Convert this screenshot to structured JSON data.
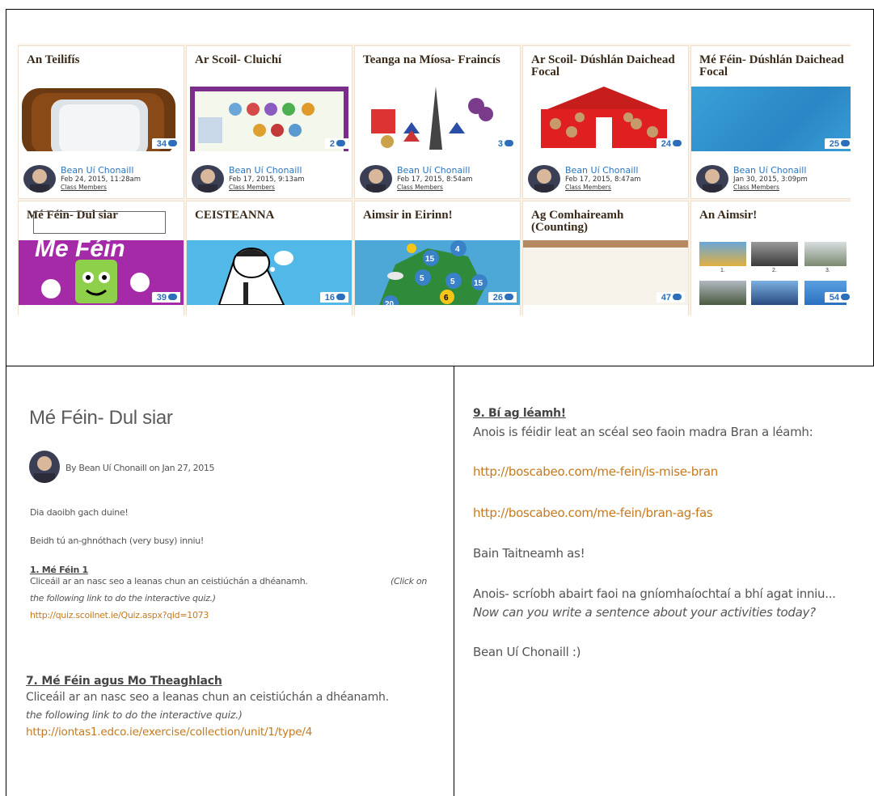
{
  "cards": [
    {
      "title": "An Teilifís",
      "count": "34",
      "author": "Bean Uí Chonaill",
      "date": "Feb 24, 2015, 11:28am",
      "group": "Class Members"
    },
    {
      "title": "Ar Scoil- Cluichí",
      "count": "2",
      "author": "Bean Uí Chonaill",
      "date": "Feb 17, 2015, 9:13am",
      "group": "Class Members"
    },
    {
      "title": "Teanga na Míosa- Fraincís",
      "count": "3",
      "author": "Bean Uí Chonaill",
      "date": "Feb 17, 2015, 8:54am",
      "group": "Class Members"
    },
    {
      "title": "Ar Scoil- Dúshlán Daichead Focal",
      "count": "24",
      "author": "Bean Uí Chonaill",
      "date": "Feb 17, 2015, 8:47am",
      "group": "Class Members"
    },
    {
      "title": "Mé Féin- Dúshlán Daichead Focal",
      "count": "25",
      "author": "Bean Uí Chonaill",
      "date": "Jan 30, 2015, 3:09pm",
      "group": "Class Members"
    },
    {
      "title": "Mé Féin- Dul siar",
      "count": "39",
      "image_text": "Me Féin"
    },
    {
      "title": "CEISTEANNA",
      "count": "16"
    },
    {
      "title": "Aimsir in Eirinn!",
      "count": "26",
      "map_numbers": [
        "4",
        "15",
        "5",
        "5",
        "15",
        "6",
        "20"
      ]
    },
    {
      "title": "Ag Comhaireamh (Counting)",
      "count": "47"
    },
    {
      "title": "An Aimsir!",
      "count": "54",
      "thumb_labels": [
        "1.",
        "2.",
        "3."
      ]
    }
  ],
  "article": {
    "title": "Mé Féin- Dul siar",
    "byline": "By Bean Uí Chonaill on Jan 27, 2015",
    "greeting": "Dia daoibh gach duine!",
    "busy": "Beidh tú an-ghnóthach (very busy) inniu!",
    "s1_heading": "1. Mé Féin 1",
    "s1_text": "Cliceáil ar an nasc seo a leanas chun an ceistiúchán a dhéanamh.",
    "s1_click": "(Click on",
    "s1_italic": "the following link to do the interactive quiz.)",
    "s1_link": "http://quiz.scoilnet.ie/Quiz.aspx?qid=1073",
    "s7_heading": "7. Mé Féin agus Mo Theaghlach",
    "s7_text": "Cliceáil ar an nasc seo a leanas chun an ceistiúchán a dhéanamh.",
    "s7_italic": "the following link to do the interactive quiz.)",
    "s7_link": "http://iontas1.edco.ie/exercise/collection/unit/1/type/4"
  },
  "right": {
    "s9_heading": "9. Bí ag léamh!",
    "s9_text": "Anois is féidir leat an scéal seo faoin madra Bran a léamh:",
    "link1": "http://boscabeo.com/me-fein/is-mise-bran",
    "link2": "http://boscabeo.com/me-fein/bran-ag-fas",
    "enjoy": "Bain Taitneamh as!",
    "write": "Anois- scríobh abairt faoi na gníomhaíochtaí a bhí agat inniu...",
    "write_en": "Now can you write a sentence about your activities today?",
    "signoff": "Bean Uí Chonaill :)"
  },
  "colors": {
    "link": "#c47a1f",
    "author": "#2c74c0",
    "badge": "#2c6fb8"
  }
}
